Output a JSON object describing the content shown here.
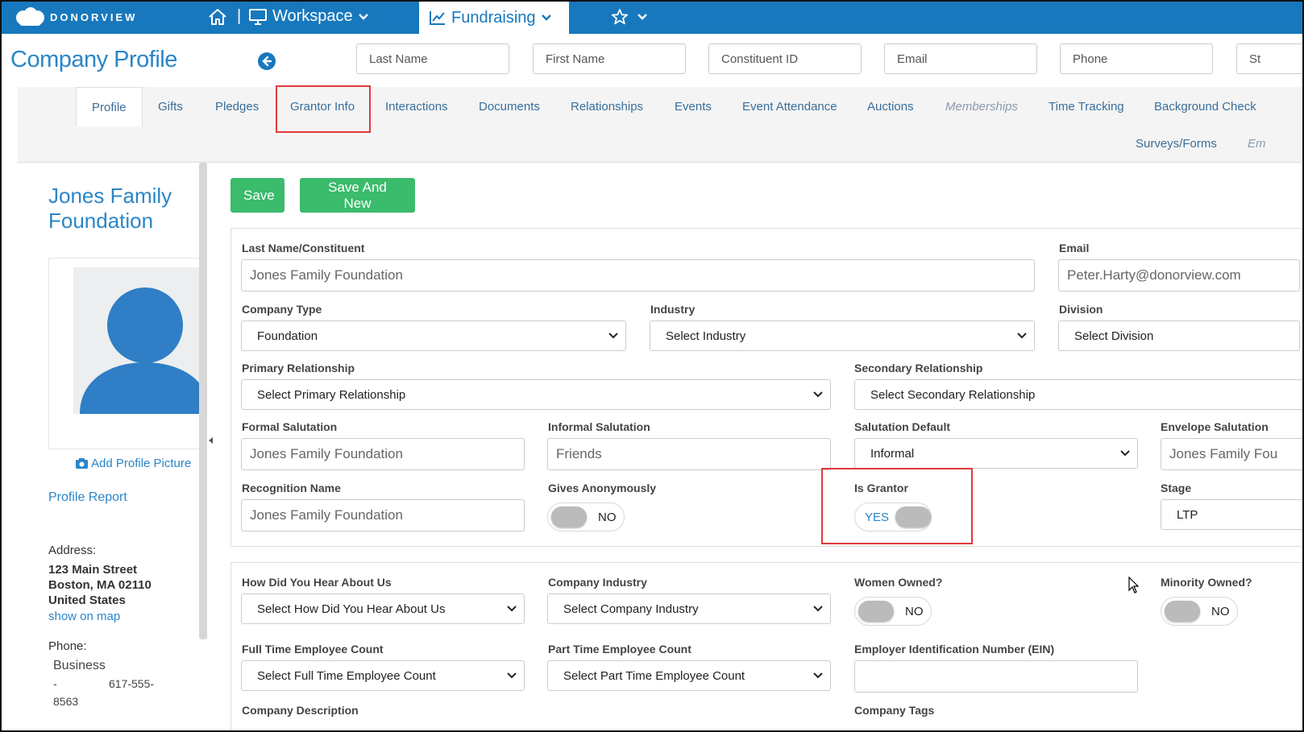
{
  "topbar": {
    "brand": "DONORVIEW",
    "separator": "|",
    "workspace_label": "Workspace",
    "fundraising_label": "Fundraising"
  },
  "header": {
    "page_title": "Company Profile",
    "search": {
      "last_name": "Last Name",
      "first_name": "First Name",
      "constituent_id": "Constituent ID",
      "email": "Email",
      "phone": "Phone",
      "overflow": "St"
    }
  },
  "tabs": [
    {
      "label": "Profile",
      "active": true
    },
    {
      "label": "Gifts"
    },
    {
      "label": "Pledges"
    },
    {
      "label": "Grantor Info",
      "highlighted": true
    },
    {
      "label": "Interactions"
    },
    {
      "label": "Documents"
    },
    {
      "label": "Relationships"
    },
    {
      "label": "Events"
    },
    {
      "label": "Event Attendance"
    },
    {
      "label": "Auctions"
    },
    {
      "label": "Memberships",
      "italic": true
    },
    {
      "label": "Time Tracking"
    },
    {
      "label": "Background Check"
    },
    {
      "label": "Surveys/Forms"
    },
    {
      "label": "Em",
      "italic": true
    }
  ],
  "sidebar": {
    "name_line1": "Jones Family",
    "name_line2": "Foundation",
    "add_picture": "Add Profile Picture",
    "profile_report": "Profile Report",
    "address_label": "Address:",
    "address_line1": "123 Main Street",
    "address_line2": "Boston, MA 02110",
    "address_line3": "United States",
    "show_on_map": "show on map",
    "phone_label": "Phone:",
    "phone_type": "Business",
    "phone_dash": "-",
    "phone_part1": "617-555-",
    "phone_part2": "8563"
  },
  "actions": {
    "save": "Save",
    "save_and_new": "Save And New"
  },
  "form": {
    "last_name_label": "Last Name/Constituent",
    "last_name_value": "Jones Family Foundation",
    "email_label": "Email",
    "email_value": "Peter.Harty@donorview.com",
    "company_type_label": "Company Type",
    "company_type_value": "Foundation",
    "industry_label": "Industry",
    "industry_value": "Select Industry",
    "division_label": "Division",
    "division_value": "Select Division",
    "primary_rel_label": "Primary Relationship",
    "primary_rel_value": "Select Primary Relationship",
    "secondary_rel_label": "Secondary Relationship",
    "secondary_rel_value": "Select Secondary Relationship",
    "formal_sal_label": "Formal Salutation",
    "formal_sal_value": "Jones Family Foundation",
    "informal_sal_label": "Informal Salutation",
    "informal_sal_value": "Friends",
    "sal_default_label": "Salutation Default",
    "sal_default_value": "Informal",
    "envelope_sal_label": "Envelope Salutation",
    "envelope_sal_value": "Jones Family Fou",
    "recognition_label": "Recognition Name",
    "recognition_value": "Jones Family Foundation",
    "gives_anon_label": "Gives Anonymously",
    "gives_anon_value": "NO",
    "is_grantor_label": "Is Grantor",
    "is_grantor_value": "YES",
    "stage_label": "Stage",
    "stage_value": "LTP",
    "hear_label": "How Did You Hear About Us",
    "hear_value": "Select How Did You Hear About Us",
    "company_industry_label": "Company Industry",
    "company_industry_value": "Select Company Industry",
    "women_owned_label": "Women Owned?",
    "women_owned_value": "NO",
    "minority_owned_label": "Minority Owned?",
    "minority_owned_value": "NO",
    "ft_count_label": "Full Time Employee Count",
    "ft_count_value": "Select Full Time Employee Count",
    "pt_count_label": "Part Time Employee Count",
    "pt_count_value": "Select Part Time Employee Count",
    "ein_label": "Employer Identification Number (EIN)",
    "ein_value": "",
    "company_desc_label": "Company Description",
    "company_tags_label": "Company Tags"
  },
  "colors": {
    "brand_blue": "#1878bd",
    "link_blue": "#2a86c8",
    "save_green": "#3bbb6c",
    "highlight_red": "#e0393b"
  }
}
